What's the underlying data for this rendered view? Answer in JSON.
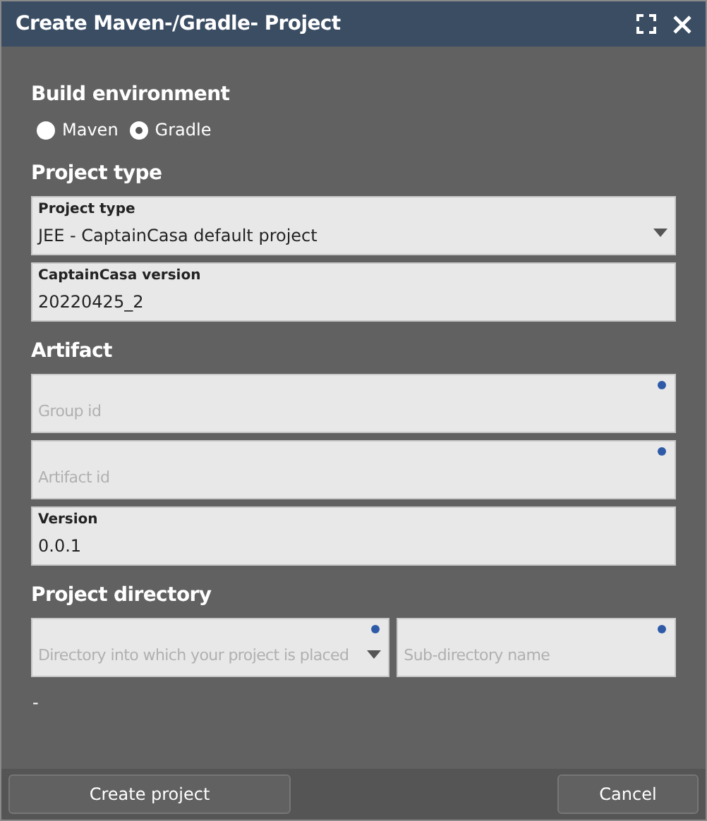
{
  "window": {
    "title": "Create Maven-/Gradle- Project"
  },
  "sections": [
    {
      "heading": "Build environment",
      "radios": [
        {
          "label": "Maven",
          "selected": false
        },
        {
          "label": "Gradle",
          "selected": true
        }
      ]
    },
    {
      "heading": "Project type",
      "rows": [
        [
          {
            "kind": "select",
            "label": "Project type",
            "value": "JEE - CaptainCasa default project",
            "required": false
          }
        ],
        [
          {
            "kind": "text",
            "label": "CaptainCasa version",
            "value": "20220425_2",
            "required": false
          }
        ]
      ]
    },
    {
      "heading": "Artifact",
      "rows": [
        [
          {
            "kind": "text",
            "placeholder": "Group id",
            "required": true
          }
        ],
        [
          {
            "kind": "text",
            "placeholder": "Artifact id",
            "required": true
          }
        ],
        [
          {
            "kind": "text",
            "label": "Version",
            "value": "0.0.1",
            "required": false
          }
        ]
      ]
    },
    {
      "heading": "Project directory",
      "rows": [
        [
          {
            "kind": "select",
            "placeholder": "Directory into which your project is placed",
            "required": true
          },
          {
            "kind": "text",
            "placeholder": "Sub-directory name",
            "required": true
          }
        ]
      ],
      "note": "-"
    }
  ],
  "buttons": [
    {
      "label": "Create project"
    },
    {
      "label": "Cancel"
    }
  ]
}
